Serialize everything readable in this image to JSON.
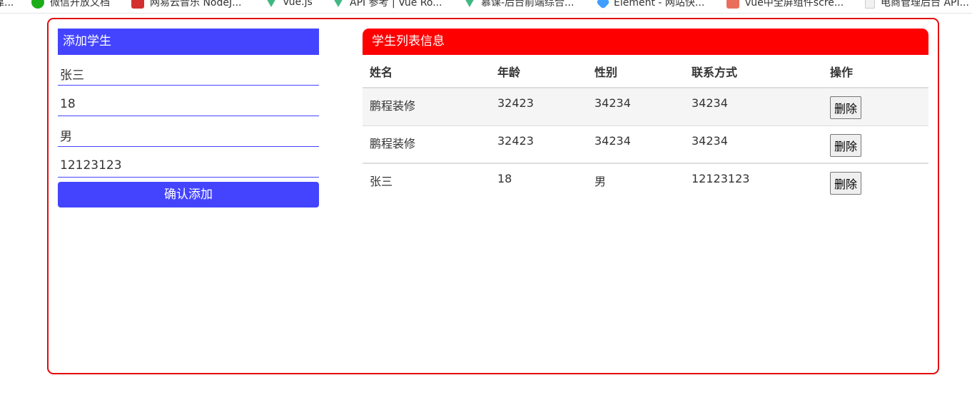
{
  "bookmarks": [
    {
      "label": "靠...",
      "icon": "none"
    },
    {
      "label": "微信开放文档",
      "icon": "wechat-icon"
    },
    {
      "label": "网易云音乐 NodeJ...",
      "icon": "netease-icon"
    },
    {
      "label": "Vue.js",
      "icon": "vue-icon"
    },
    {
      "label": "API 参考 | Vue Ro...",
      "icon": "vue-icon"
    },
    {
      "label": "慕课-后台前端综合...",
      "icon": "vue-icon"
    },
    {
      "label": "Element - 网站快...",
      "icon": "element-icon"
    },
    {
      "label": "vue中全屏组件scre...",
      "icon": "jianshu-icon"
    },
    {
      "label": "电商管理后台 API...",
      "icon": "document-icon"
    }
  ],
  "add_form": {
    "title": "添加学生",
    "name_value": "张三",
    "age_value": "18",
    "gender_value": "男",
    "contact_value": "12123123",
    "submit_label": "确认添加"
  },
  "student_list": {
    "title": "学生列表信息",
    "columns": [
      "姓名",
      "年龄",
      "性别",
      "联系方式",
      "操作"
    ],
    "rows": [
      {
        "name": "鹏程装修",
        "age": "32423",
        "gender": "34234",
        "contact": "34234",
        "action": "删除"
      },
      {
        "name": "鹏程装修",
        "age": "32423",
        "gender": "34234",
        "contact": "34234",
        "action": "删除"
      },
      {
        "name": "张三",
        "age": "18",
        "gender": "男",
        "contact": "12123123",
        "action": "删除"
      }
    ]
  },
  "colors": {
    "frame_border": "#e4080a",
    "add_accent": "#4444ff",
    "list_header": "#ff0000"
  }
}
